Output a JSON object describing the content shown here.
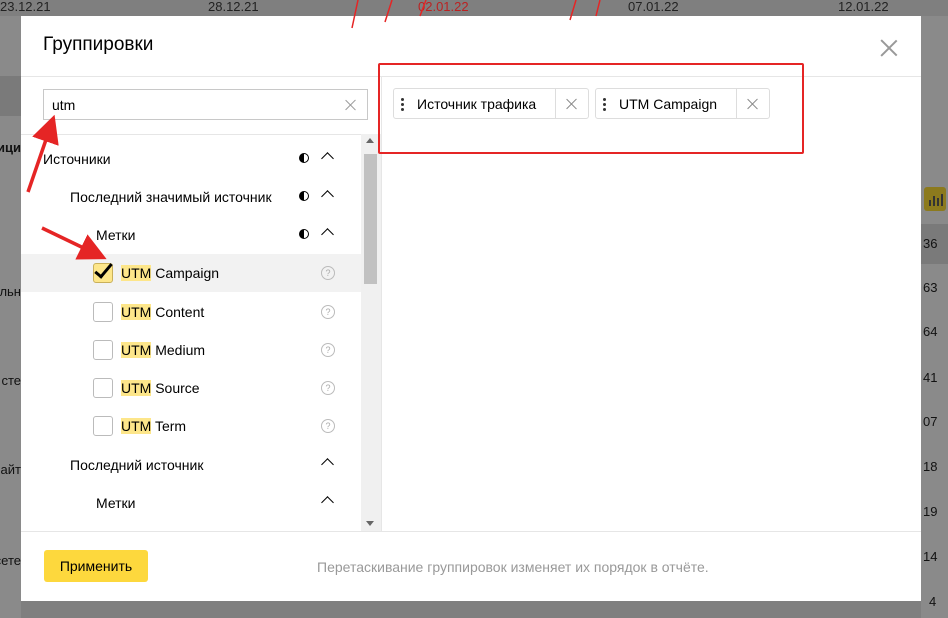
{
  "background": {
    "dates": [
      "23.12.21",
      "28.12.21",
      "02.01.22",
      "07.01.22",
      "12.01.22"
    ],
    "left_fragments": [
      "ици",
      "льн",
      "сте",
      "айт",
      "сете"
    ],
    "right_values": [
      "36",
      "63",
      "64",
      "41",
      "07",
      "18",
      "19",
      "14",
      "4"
    ]
  },
  "modal": {
    "title": "Группировки",
    "search": {
      "value": "utm",
      "placeholder": ""
    },
    "tree": [
      {
        "label": "Источники",
        "highlight": "",
        "rest": "",
        "level": 0,
        "has_contrast_icon": true,
        "expanded": true
      },
      {
        "label": "Последний значимый источник",
        "highlight": "",
        "rest": "",
        "level": 1,
        "has_contrast_icon": true,
        "expanded": true
      },
      {
        "label": "Метки",
        "highlight": "",
        "rest": "",
        "level": 2,
        "has_contrast_icon": true,
        "expanded": true
      },
      {
        "label": "",
        "highlight": "UTM",
        "rest": " Campaign",
        "checkbox": true,
        "checked": true,
        "help": true
      },
      {
        "label": "",
        "highlight": "UTM",
        "rest": " Content",
        "checkbox": true,
        "checked": false,
        "help": true
      },
      {
        "label": "",
        "highlight": "UTM",
        "rest": " Medium",
        "checkbox": true,
        "checked": false,
        "help": true
      },
      {
        "label": "",
        "highlight": "UTM",
        "rest": " Source",
        "checkbox": true,
        "checked": false,
        "help": true
      },
      {
        "label": "",
        "highlight": "UTM",
        "rest": " Term",
        "checkbox": true,
        "checked": false,
        "help": true
      },
      {
        "label": "Последний источник",
        "highlight": "",
        "rest": "",
        "level": 1,
        "has_contrast_icon": false,
        "expanded": true
      },
      {
        "label": "Метки",
        "highlight": "",
        "rest": "",
        "level": 2,
        "has_contrast_icon": false,
        "expanded": true
      }
    ],
    "selected_groupings": [
      {
        "label": "Источник трафика"
      },
      {
        "label": "UTM Campaign"
      }
    ],
    "apply_label": "Применить",
    "footer_hint": "Перетаскивание группировок изменяет их порядок в отчёте.",
    "help_glyph": "?"
  },
  "colors": {
    "apply_button": "#fdd83d",
    "highlight": "#fde68a",
    "annotation_red": "#e52525",
    "overlay": "#7f7f7f"
  }
}
